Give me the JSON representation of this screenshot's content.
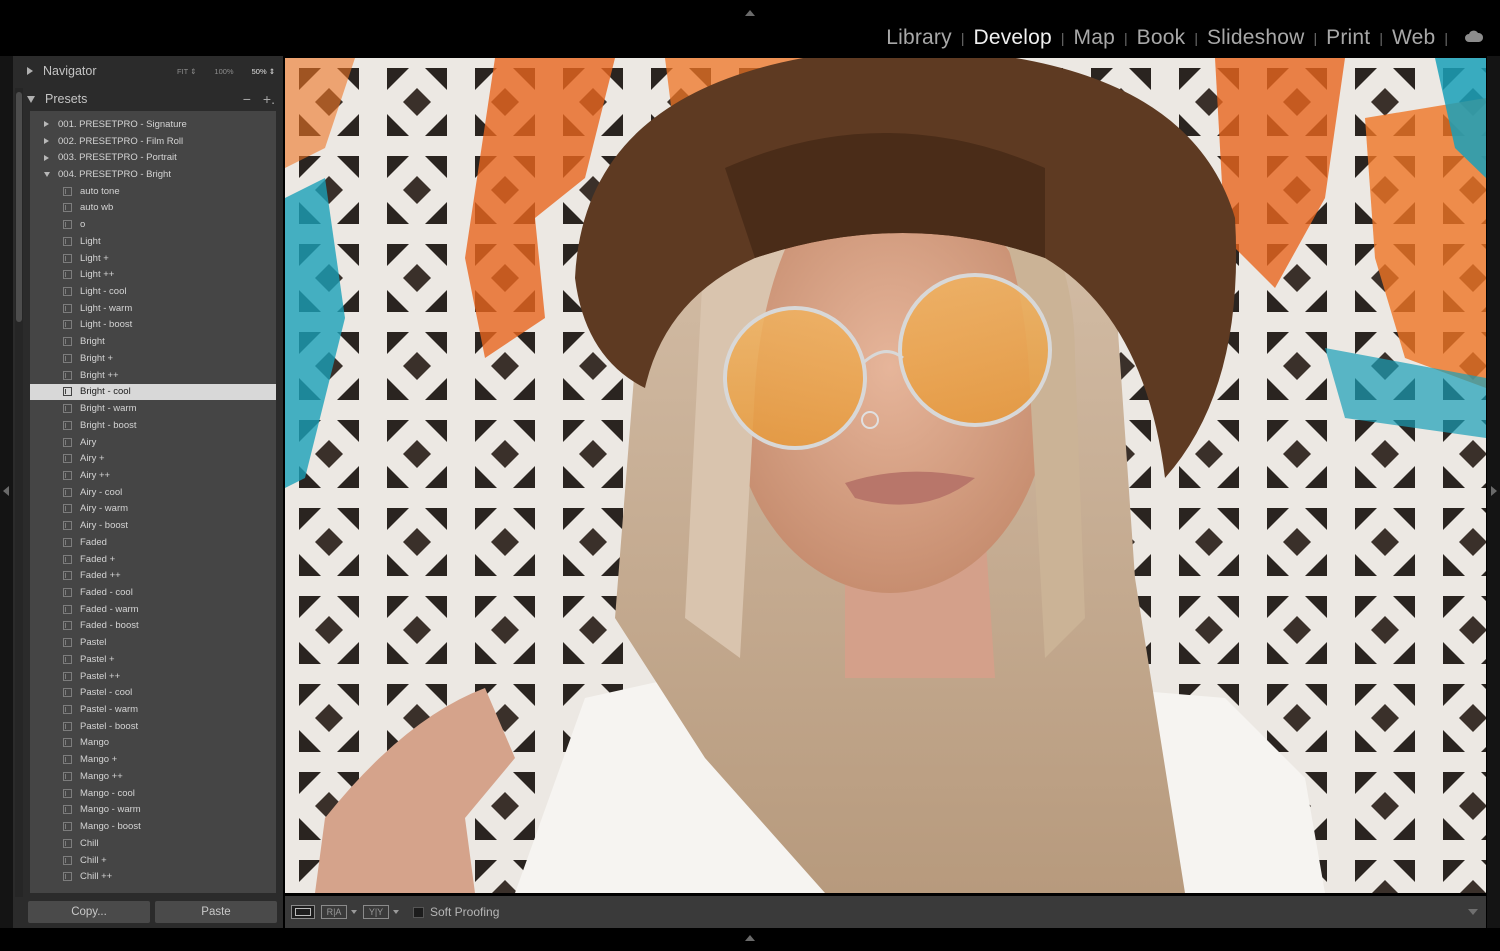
{
  "modules": [
    {
      "label": "Library",
      "active": false
    },
    {
      "label": "Develop",
      "active": true
    },
    {
      "label": "Map",
      "active": false
    },
    {
      "label": "Book",
      "active": false
    },
    {
      "label": "Slideshow",
      "active": false
    },
    {
      "label": "Print",
      "active": false
    },
    {
      "label": "Web",
      "active": false
    }
  ],
  "module_separator": "|",
  "navigator": {
    "title": "Navigator",
    "zoom_options": [
      "FIT ⇕",
      "100%",
      "50% ⇕"
    ],
    "zoom_active": "50% ⇕"
  },
  "presets": {
    "title": "Presets",
    "minus": "−",
    "plus": "+.",
    "folders": [
      {
        "label": "001. PRESETPRO - Signature",
        "open": false
      },
      {
        "label": "002. PRESETPRO - Film Roll",
        "open": false
      },
      {
        "label": "003. PRESETPRO - Portrait",
        "open": false
      },
      {
        "label": "004. PRESETPRO - Bright",
        "open": true
      }
    ],
    "items": [
      "auto tone",
      "auto wb",
      "o",
      "Light",
      "Light +",
      "Light ++",
      "Light - cool",
      "Light - warm",
      "Light - boost",
      "Bright",
      "Bright +",
      "Bright ++",
      "Bright - cool",
      "Bright - warm",
      "Bright - boost",
      "Airy",
      "Airy +",
      "Airy ++",
      "Airy - cool",
      "Airy - warm",
      "Airy - boost",
      "Faded",
      "Faded +",
      "Faded ++",
      "Faded - cool",
      "Faded - warm",
      "Faded - boost",
      "Pastel",
      "Pastel +",
      "Pastel ++",
      "Pastel - cool",
      "Pastel - warm",
      "Pastel - boost",
      "Mango",
      "Mango +",
      "Mango ++",
      "Mango - cool",
      "Mango - warm",
      "Mango - boost",
      "Chill",
      "Chill +",
      "Chill ++"
    ],
    "selected_item": "Bright - cool"
  },
  "buttons": {
    "copy": "Copy...",
    "paste": "Paste"
  },
  "toolbar": {
    "view_mode_icon": "loupe-view-icon",
    "before_after_label": "R|A",
    "compare_label": "Y|Y",
    "soft_proofing_label": "Soft Proofing",
    "soft_proofing_checked": false
  },
  "colors": {
    "accent_selected": "#d8d8d8",
    "panel_bg": "#2b2b2b",
    "list_bg": "#454545",
    "wall_orange": "#e8651e",
    "wall_teal": "#1aa0b8"
  }
}
